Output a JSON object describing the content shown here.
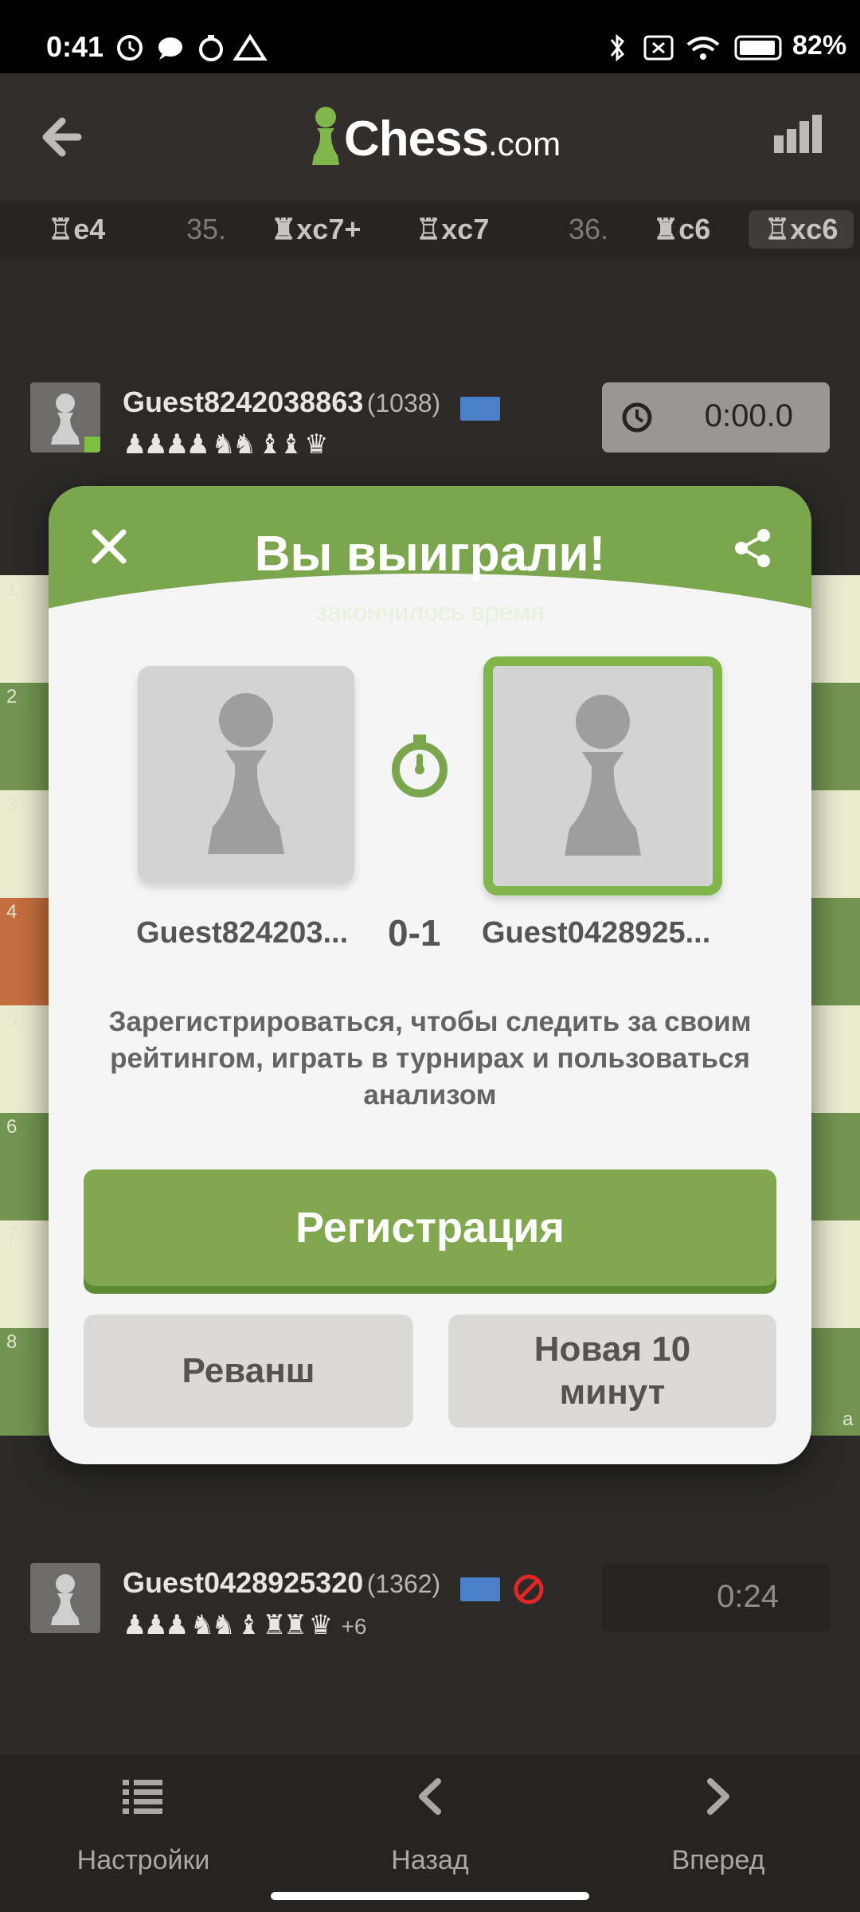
{
  "status_bar": {
    "time": "0:41",
    "battery": "82%"
  },
  "header": {
    "brand": "Chess",
    "brand_suffix": ".com"
  },
  "moves": {
    "m1": "e4",
    "n35": "35.",
    "m2": "xc7+",
    "m3": "xc7",
    "n36": "36.",
    "m4": "c6",
    "m5": "xc6"
  },
  "top_player": {
    "name": "Guest8242038863",
    "rating": "(1038)",
    "captured": "♟♟♟♟ ♞♞ ♝♝ ♛",
    "clock": "0:00.0"
  },
  "bottom_player": {
    "name": "Guest0428925320",
    "rating": "(1362)",
    "captured": "♟♟♟ ♞♞ ♝ ♜♜ ♛",
    "material": "+6",
    "clock": "0:24"
  },
  "board": {
    "ranks": [
      "1",
      "2",
      "3",
      "4",
      "5",
      "6",
      "7",
      "8"
    ],
    "file_label": "a",
    "colors": {
      "light": "#ebecd0",
      "dark": "#739552",
      "highlight": "#c56e3f"
    }
  },
  "modal": {
    "title": "Вы выиграли!",
    "subtitle": "закончилось время",
    "left_player": "Guest824203...",
    "score": "0-1",
    "right_player": "Guest0428925...",
    "message": "Зарегистрироваться, чтобы следить за своим рейтингом, играть в турнирах и пользоваться анализом",
    "register_button": "Регистрация",
    "rematch_button": "Реванш",
    "new_game_button": "Новая 10 минут"
  },
  "bottom_nav": {
    "settings": "Настройки",
    "back": "Назад",
    "forward": "Вперед"
  },
  "icons": [
    "back-arrow-icon",
    "stats-icon",
    "close-icon",
    "share-icon",
    "stopwatch-icon",
    "clock-icon",
    "flag-icon",
    "no-icon",
    "list-icon",
    "chevron-left-icon",
    "chevron-right-icon"
  ]
}
